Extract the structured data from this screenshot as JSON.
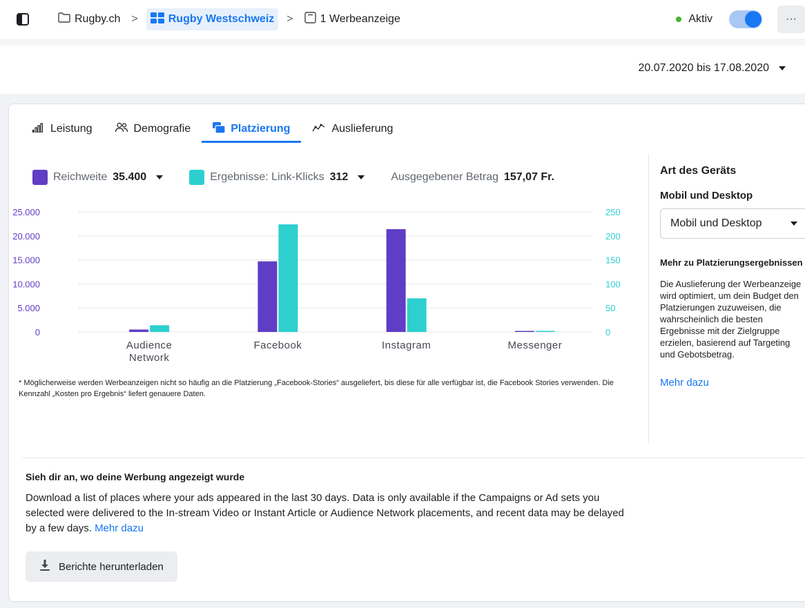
{
  "breadcrumb": {
    "items": [
      {
        "label": "Rugby.ch",
        "icon": "folder-icon"
      },
      {
        "label": "Rugby Westschweiz",
        "icon": "grid-icon"
      },
      {
        "label": "1 Werbeanzeige",
        "icon": "ad-icon"
      }
    ]
  },
  "status": {
    "label": "Aktiv",
    "color": "#42b72a",
    "toggle_on": true
  },
  "more_label": "···",
  "date_range": "20.07.2020 bis 17.08.2020",
  "tabs": [
    {
      "label": "Leistung",
      "icon": "bar-chart-icon"
    },
    {
      "label": "Demografie",
      "icon": "people-icon"
    },
    {
      "label": "Platzierung",
      "icon": "placement-icon",
      "active": true
    },
    {
      "label": "Auslieferung",
      "icon": "delivery-icon"
    }
  ],
  "metrics": {
    "reach": {
      "label": "Reichweite",
      "value": "35.400",
      "color": "#5f3dc4"
    },
    "results": {
      "label": "Ergebnisse: Link-Klicks",
      "value": "312",
      "color": "#2ecfcf"
    },
    "spent": {
      "label": "Ausgegebener Betrag",
      "value": "157,07 Fr."
    }
  },
  "chart_data": {
    "type": "bar",
    "categories": [
      "Audience Network",
      "Facebook",
      "Instagram",
      "Messenger"
    ],
    "category_lines": [
      [
        "Audience",
        "Network"
      ],
      [
        "Facebook"
      ],
      [
        "Instagram"
      ],
      [
        "Messenger"
      ]
    ],
    "series": [
      {
        "name": "Reichweite",
        "axis": "left",
        "color": "#5f3dc4",
        "values": [
          500,
          14700,
          21400,
          150
        ]
      },
      {
        "name": "Ergebnisse: Link-Klicks",
        "axis": "right",
        "color": "#2ecfcf",
        "values": [
          14,
          224,
          70,
          1
        ]
      }
    ],
    "left_axis": {
      "ylim": [
        0,
        25000
      ],
      "ticks": [
        "0",
        "5.000",
        "10.000",
        "15.000",
        "20.000",
        "25.000"
      ],
      "color": "#5f3dc4"
    },
    "right_axis": {
      "ylim": [
        0,
        250
      ],
      "ticks": [
        "0",
        "50",
        "100",
        "150",
        "200",
        "250"
      ],
      "color": "#2ecfcf"
    },
    "grid": true
  },
  "footnote": "* Möglicherweise werden Werbeanzeigen nicht so häufig an die Platzierung „Facebook-Stories“ ausgeliefert, bis diese für alle verfügbar ist, die Facebook Stories verwenden. Die Kennzahl „Kosten pro Ergebnis“ liefert genauere Daten.",
  "right_panel": {
    "title": "Art des Geräts",
    "subtitle": "Mobil und Desktop",
    "select_value": "Mobil und Desktop",
    "more_title": "Mehr zu Platzierungsergebnissen",
    "text": "Die Auslieferung der Werbeanzeige wird optimiert, um dein Budget den Platzierungen zuzuweisen, die wahrscheinlich die besten Ergebnisse mit der Zielgruppe erzielen, basierend auf Targeting und Gebotsbetrag.",
    "link": "Mehr dazu"
  },
  "bottom": {
    "title": "Sieh dir an, wo deine Werbung angezeigt wurde",
    "text": "Download a list of places where your ads appeared in the last 30 days. Data is only available if the Campaigns or Ad sets you selected were delivered to the In-stream Video or Instant Article or Audience Network placements, and recent data may be delayed by a few days.",
    "link": "Mehr dazu",
    "button": "Berichte herunterladen"
  }
}
